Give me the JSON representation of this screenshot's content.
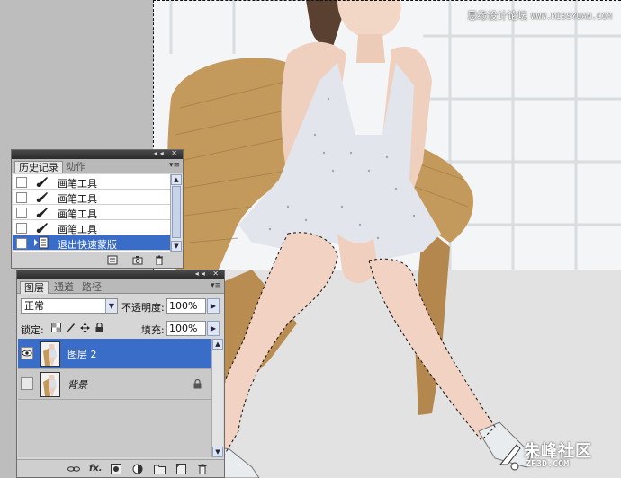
{
  "watermark_top": {
    "cn": "思缘设计论坛",
    "site": "WWW.MISSYUAN.COM"
  },
  "watermark_logo": {
    "name": "朱峰社区",
    "url": "ZF3D.COM"
  },
  "history_panel": {
    "tabs": [
      {
        "label": "历史记录",
        "active": true
      },
      {
        "label": "动作",
        "active": false
      }
    ],
    "items": [
      {
        "label": "画笔工具",
        "icon": "brush-icon",
        "selected": false
      },
      {
        "label": "画笔工具",
        "icon": "brush-icon",
        "selected": false
      },
      {
        "label": "画笔工具",
        "icon": "brush-icon",
        "selected": false
      },
      {
        "label": "画笔工具",
        "icon": "brush-icon",
        "selected": false
      },
      {
        "label": "退出快速蒙版",
        "icon": "exit-quick-mask-icon",
        "selected": true
      }
    ],
    "footer_icons": [
      "new-document-from-state-icon",
      "new-snapshot-icon",
      "delete-state-icon"
    ]
  },
  "layers_panel": {
    "tabs": [
      {
        "label": "图层",
        "active": true
      },
      {
        "label": "通道",
        "active": false
      },
      {
        "label": "路径",
        "active": false
      }
    ],
    "blend_mode": "正常",
    "opacity_label": "不透明度:",
    "opacity_value": "100%",
    "lock_label": "锁定:",
    "fill_label": "填充:",
    "fill_value": "100%",
    "layers": [
      {
        "name": "图层 2",
        "visible": true,
        "selected": true,
        "locked": false
      },
      {
        "name": "背景",
        "visible": false,
        "selected": false,
        "locked": true
      }
    ],
    "footer_icons": [
      "link-layers-icon",
      "fx-icon",
      "add-mask-icon",
      "adjustment-layer-icon",
      "new-group-icon",
      "new-layer-icon",
      "delete-layer-icon"
    ],
    "footer_fx": "fx."
  },
  "colors": {
    "selection_blue": "#3a6dc7",
    "panel_bg": "#d6d6d6",
    "titlebar": "#2a2a2a"
  }
}
